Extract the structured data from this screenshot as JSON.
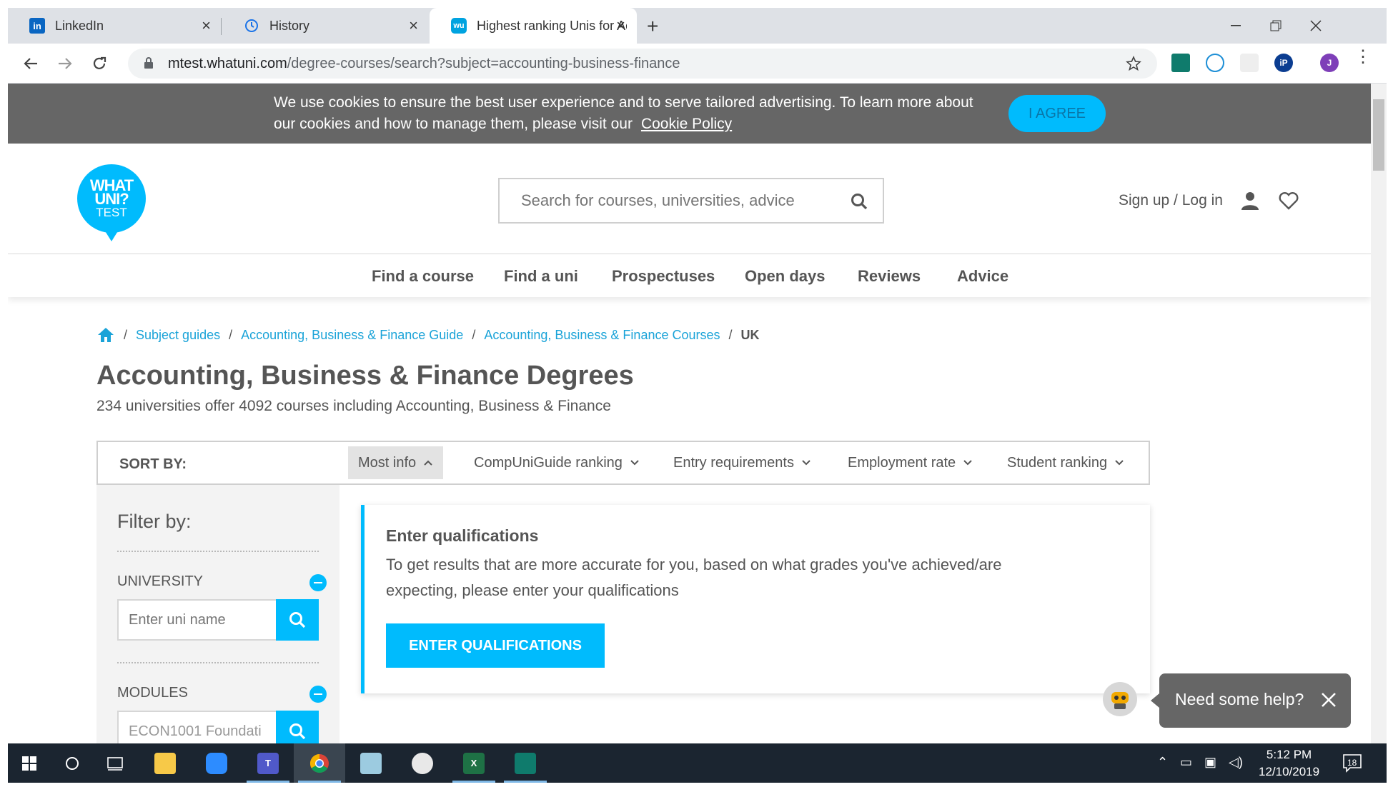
{
  "browser": {
    "tabs": [
      {
        "title": "LinkedIn",
        "icon": "linkedin-icon"
      },
      {
        "title": "History",
        "icon": "history-icon"
      },
      {
        "title": "Highest ranking Unis for Accounti",
        "icon": "whatuni-icon"
      }
    ],
    "url_host": "mtest.whatuni.com",
    "url_path": "/degree-courses/search?subject=accounting-business-finance",
    "new_tab": "+"
  },
  "cookie_banner": {
    "text": "We use cookies to ensure the best user experience and to serve tailored advertising. To learn more about our cookies and how to manage them, please visit our",
    "link": "Cookie Policy",
    "agree_label": "I AGREE"
  },
  "header": {
    "logo": {
      "line1": "WHAT",
      "line2": "UNI?",
      "line3": "TEST"
    },
    "search_placeholder": "Search for courses, universities, advice",
    "signup_label": "Sign up / Log in"
  },
  "nav": {
    "items": [
      "Find a course",
      "Find a uni",
      "Prospectuses",
      "Open days",
      "Reviews",
      "Advice"
    ]
  },
  "breadcrumb": {
    "items": [
      "Subject guides",
      "Accounting, Business & Finance Guide",
      "Accounting, Business & Finance Courses"
    ],
    "current": "UK",
    "separator": "/"
  },
  "page": {
    "title": "Accounting, Business & Finance Degrees",
    "subtitle": "234 universities offer 4092 courses including Accounting, Business & Finance"
  },
  "sort": {
    "label": "SORT BY:",
    "options": [
      "Most info",
      "CompUniGuide ranking",
      "Entry requirements",
      "Employment rate",
      "Student ranking"
    ]
  },
  "filter": {
    "title": "Filter by:",
    "university_label": "UNIVERSITY",
    "university_placeholder": "Enter uni name",
    "modules_label": "MODULES",
    "modules_value": "ECON1001 Foundati"
  },
  "qualifications": {
    "title": "Enter qualifications",
    "text": "To get results that are more accurate for you, based on what grades you've achieved/are expecting, please enter your qualifications",
    "button": "ENTER QUALIFICATIONS"
  },
  "chat": {
    "help_text": "Need some help?"
  },
  "taskbar": {
    "time": "5:12 PM",
    "date": "12/10/2019",
    "notifications": "18"
  },
  "colors": {
    "accent": "#00bbfd",
    "banner": "#666666",
    "text": "#555555",
    "taskbar": "#1b2530"
  }
}
